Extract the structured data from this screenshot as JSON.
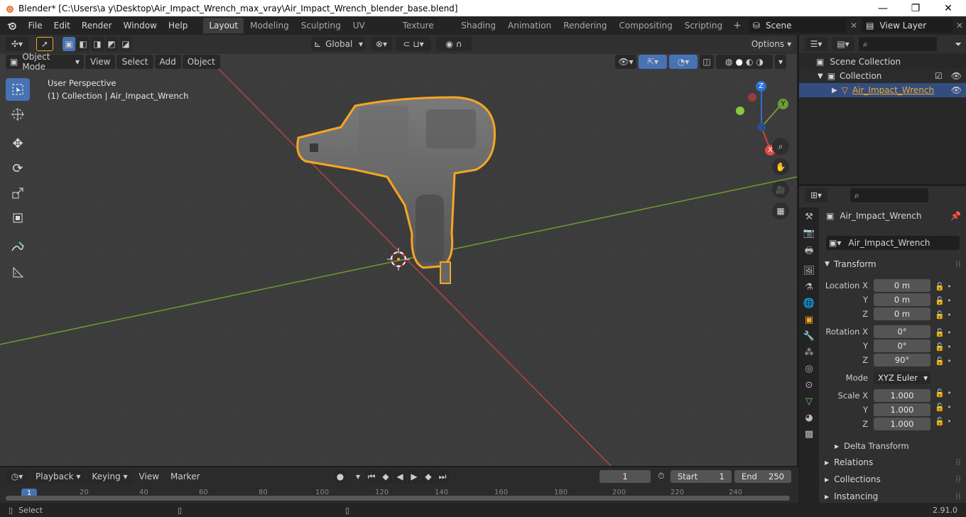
{
  "window": {
    "title": "Blender* [C:\\Users\\a y\\Desktop\\Air_Impact_Wrench_max_vray\\Air_Impact_Wrench_blender_base.blend]",
    "minimize": "—",
    "maximize": "❐",
    "close": "✕"
  },
  "menu": [
    "File",
    "Edit",
    "Render",
    "Window",
    "Help"
  ],
  "workspaces": [
    "Layout",
    "Modeling",
    "Sculpting",
    "UV Editing",
    "Texture Paint",
    "Shading",
    "Animation",
    "Rendering",
    "Compositing",
    "Scripting"
  ],
  "scene": {
    "label": "Scene",
    "view_layer": "View Layer"
  },
  "viewport_header": {
    "mode": "Object Mode",
    "menus": [
      "View",
      "Select",
      "Add",
      "Object"
    ],
    "orientation": "Global",
    "options": "Options"
  },
  "overlay_text": {
    "line1": "User Perspective",
    "line2": "(1) Collection | Air_Impact_Wrench"
  },
  "gizmo": {
    "z": "Z",
    "y": "Y",
    "x": "X"
  },
  "outliner": {
    "scene_collection": "Scene Collection",
    "collection": "Collection",
    "object": "Air_Impact_Wrench"
  },
  "properties": {
    "object_name": "Air_Impact_Wrench",
    "data_name": "Air_Impact_Wrench",
    "transform_label": "Transform",
    "location": {
      "label_x": "Location X",
      "label_y": "Y",
      "label_z": "Z",
      "x": "0 m",
      "y": "0 m",
      "z": "0 m"
    },
    "rotation": {
      "label_x": "Rotation X",
      "label_y": "Y",
      "label_z": "Z",
      "x": "0°",
      "y": "0°",
      "z": "90°"
    },
    "mode_label": "Mode",
    "mode_value": "XYZ Euler",
    "scale": {
      "label_x": "Scale X",
      "label_y": "Y",
      "label_z": "Z",
      "x": "1.000",
      "y": "1.000",
      "z": "1.000"
    },
    "delta_transform": "Delta Transform",
    "sections": [
      "Relations",
      "Collections",
      "Instancing"
    ]
  },
  "timeline": {
    "menus": [
      "Playback",
      "Keying",
      "View",
      "Marker"
    ],
    "current_frame": "1",
    "start_label": "Start",
    "start": "1",
    "end_label": "End",
    "end": "250",
    "ruler": [
      "1",
      "20",
      "40",
      "60",
      "80",
      "100",
      "120",
      "140",
      "160",
      "180",
      "200",
      "220",
      "240"
    ]
  },
  "status": {
    "select": "Select",
    "version": "2.91.0"
  },
  "colors": {
    "accent": "#4772b3",
    "selection": "#f5a623",
    "x_axis": "#b5443f",
    "y_axis": "#6e9b32"
  }
}
